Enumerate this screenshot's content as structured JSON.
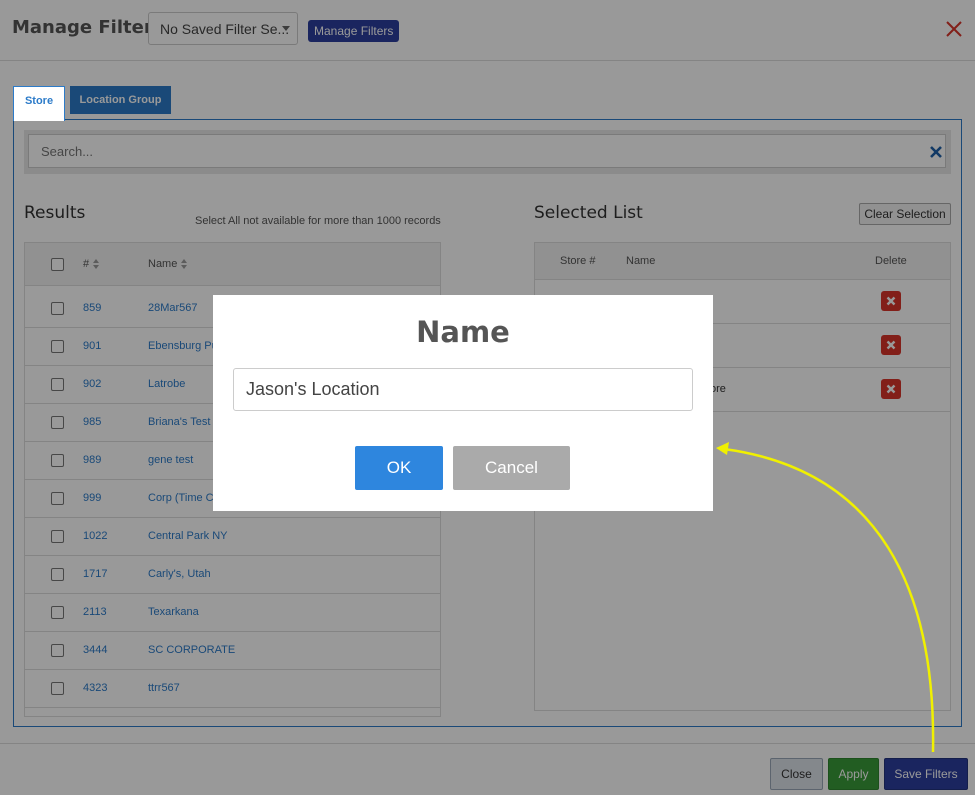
{
  "header": {
    "title": "Manage Filters",
    "saved_filter_value": "No Saved Filter Se...",
    "manage_filters_label": "Manage Filters"
  },
  "tabs": [
    {
      "label": "Store",
      "active": true
    },
    {
      "label": "Location Group",
      "active": false
    }
  ],
  "search": {
    "placeholder": "Search..."
  },
  "results": {
    "title": "Results",
    "note": "Select All not available for more than 1000 records",
    "columns": {
      "num": "#",
      "name": "Name"
    },
    "rows": [
      {
        "num": "859",
        "name": "28Mar567"
      },
      {
        "num": "901",
        "name": "Ebensburg Pu"
      },
      {
        "num": "902",
        "name": "Latrobe"
      },
      {
        "num": "985",
        "name": "Briana's Test"
      },
      {
        "num": "989",
        "name": "gene test"
      },
      {
        "num": "999",
        "name": "Corp (Time C"
      },
      {
        "num": "1022",
        "name": "Central Park NY"
      },
      {
        "num": "1717",
        "name": "Carly's, Utah"
      },
      {
        "num": "2113",
        "name": "Texarkana"
      },
      {
        "num": "3444",
        "name": "SC CORPORATE"
      },
      {
        "num": "4323",
        "name": "ttrr567"
      }
    ]
  },
  "selected": {
    "title": "Selected List",
    "clear_label": "Clear Selection",
    "columns": {
      "num": "Store #",
      "name": "Name",
      "delete": "Delete"
    },
    "rows": [
      {
        "num": "",
        "name": ""
      },
      {
        "num": "",
        "name": ""
      },
      {
        "num": "",
        "name": "ore"
      }
    ]
  },
  "footer": {
    "close_label": "Close",
    "apply_label": "Apply",
    "save_label": "Save Filters"
  },
  "dialog": {
    "title": "Name",
    "input_value": "Jason's Location",
    "ok_label": "OK",
    "cancel_label": "Cancel"
  },
  "colors": {
    "accent_blue": "#2c7bc9",
    "navy": "#2c3e9e",
    "apply_green": "#3a9b3a",
    "delete_red": "#d9342b",
    "ok_blue": "#2e86de",
    "annotation_yellow": "#f0f000"
  }
}
